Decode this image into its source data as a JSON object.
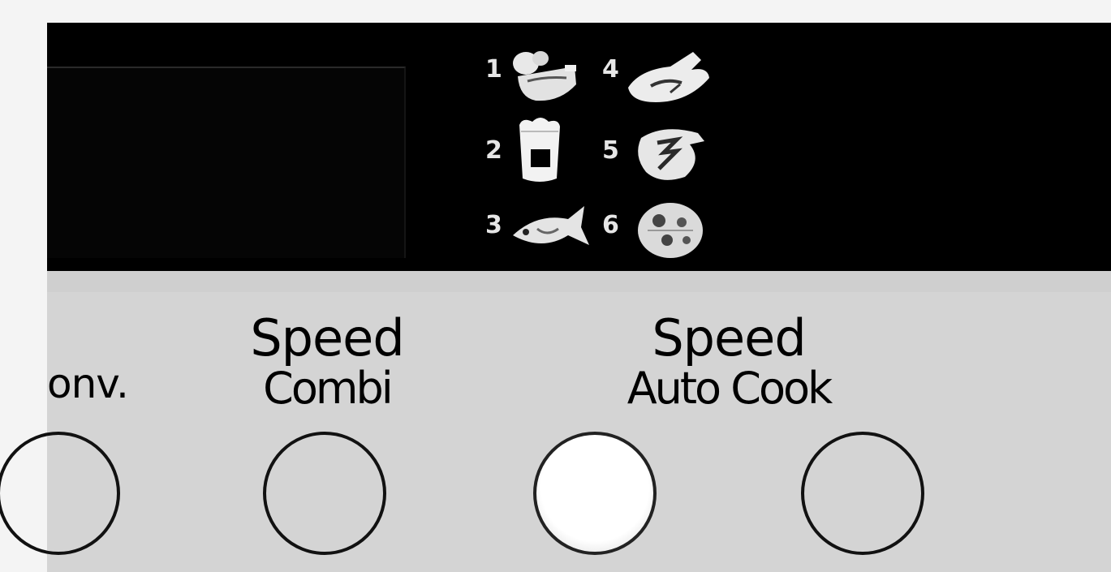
{
  "panel": {
    "colors": {
      "display_background": "#000000",
      "panel_background": "#d4d4d4",
      "active_button": "#ffffff"
    }
  },
  "display": {
    "auto_cook_icons": [
      {
        "number": "1",
        "icon": "vegetable-icon"
      },
      {
        "number": "2",
        "icon": "cup-icon"
      },
      {
        "number": "3",
        "icon": "fish-icon"
      },
      {
        "number": "4",
        "icon": "chicken-leg-icon"
      },
      {
        "number": "5",
        "icon": "pot-icon"
      },
      {
        "number": "6",
        "icon": "pizza-icon"
      }
    ]
  },
  "buttons": {
    "conv": {
      "label": "onv."
    },
    "speed_combi": {
      "line1": "Speed",
      "line2": "Combi"
    },
    "speed_auto_cook": {
      "line1": "Speed",
      "line2": "Auto Cook"
    }
  }
}
